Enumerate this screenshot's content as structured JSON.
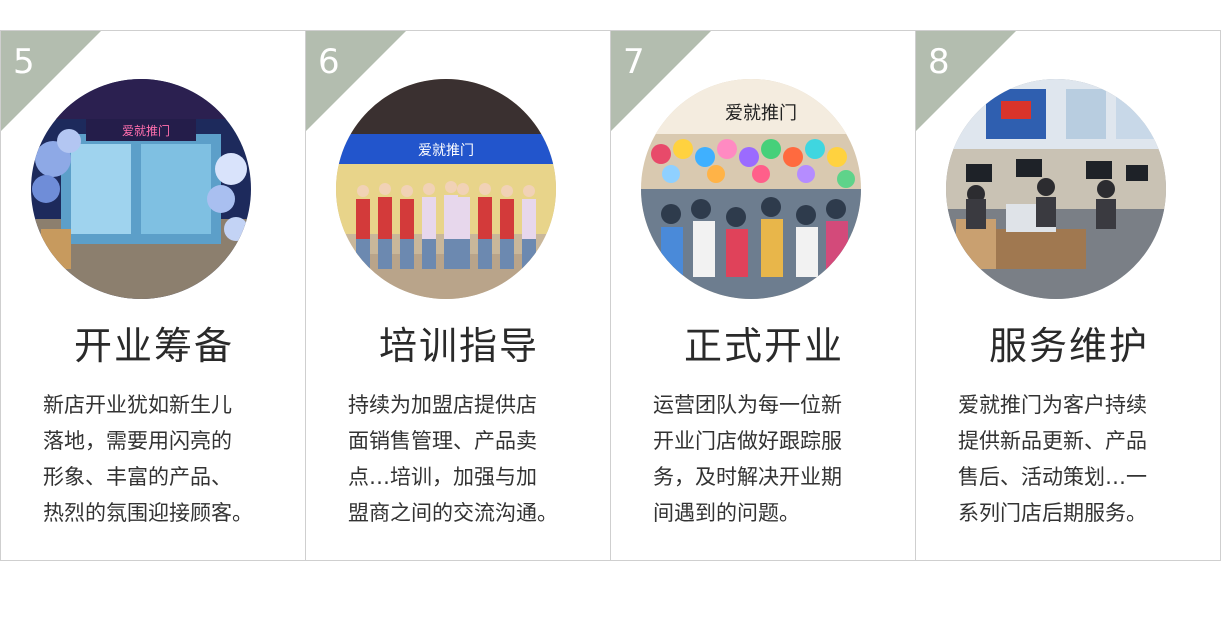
{
  "cards": [
    {
      "number": "5",
      "title": "开业筹备",
      "lines": [
        "新店开业犹如新生儿",
        "落地，需要用闪亮的",
        "形象、丰富的产品、",
        "热烈的氛围迎接顾客。"
      ],
      "photo_sign": "爱就推门"
    },
    {
      "number": "6",
      "title": "培训指导",
      "lines": [
        "持续为加盟店提供店",
        "面销售管理、产品卖",
        "点…培训，加强与加",
        "盟商之间的交流沟通。"
      ],
      "photo_sign": "爱就推门"
    },
    {
      "number": "7",
      "title": "正式开业",
      "lines": [
        "运营团队为每一位新",
        "开业门店做好跟踪服",
        "务，及时解决开业期",
        "间遇到的问题。"
      ],
      "photo_sign": "爱就推门"
    },
    {
      "number": "8",
      "title": "服务维护",
      "lines": [
        "爱就推门为客户持续",
        "提供新品更新、产品",
        "售后、活动策划…一",
        "系列门店后期服务。"
      ],
      "photo_sign": ""
    }
  ],
  "colors": {
    "corner": "#b3bdaf",
    "border": "#cfcfcf",
    "title": "#2a2a2a",
    "text": "#333333"
  }
}
